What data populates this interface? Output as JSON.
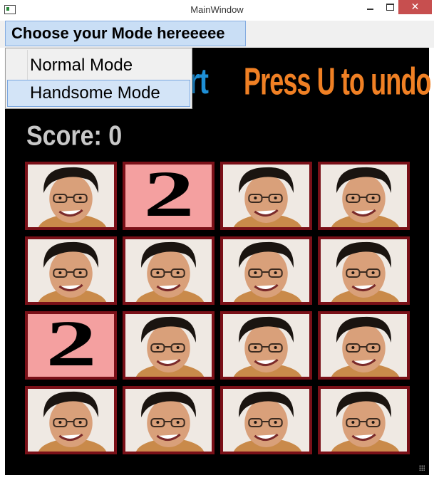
{
  "window": {
    "title": "MainWindow"
  },
  "menu": {
    "header_label": "Choose your Mode hereeeee",
    "items": [
      {
        "label": "Normal Mode"
      },
      {
        "label": "Handsome Mode"
      }
    ]
  },
  "game": {
    "restart_text": "rt",
    "undo_text": "Press U to undo",
    "score_text": "Score: 0",
    "board": [
      [
        "face",
        "2",
        "face",
        "face"
      ],
      [
        "face",
        "face",
        "face",
        "face"
      ],
      [
        "2",
        "face",
        "face",
        "face"
      ],
      [
        "face",
        "face",
        "face",
        "face"
      ]
    ]
  },
  "colors": {
    "restart_text": "#1e8fd6",
    "undo_text": "#f08024",
    "score_text": "#c8c8c8",
    "tile_border": "#7a1018",
    "two_tile_bg": "#f4a0a0",
    "background": "#000000",
    "menu_highlight": "#c9def5"
  }
}
